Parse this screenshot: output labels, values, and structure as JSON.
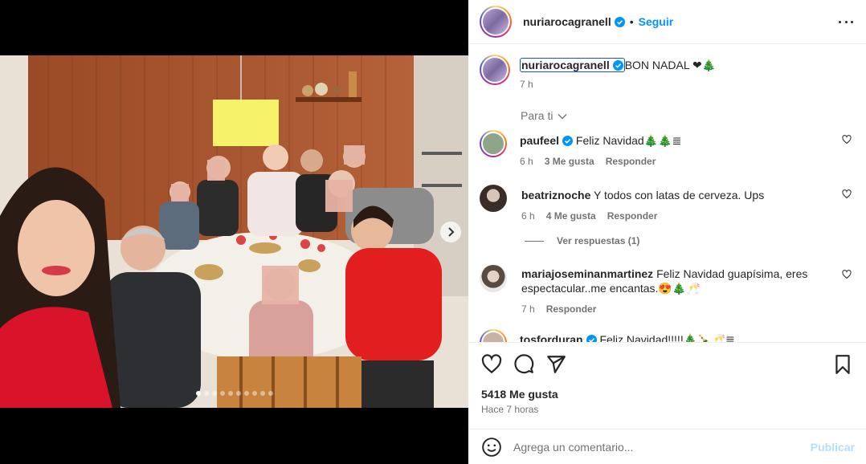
{
  "post": {
    "author": "nuriarocagranell",
    "follow_label": "Seguir",
    "separator": "•",
    "caption_text": "BON NADAL ❤🎄",
    "caption_time": "7 h",
    "filter_label": "Para ti",
    "likes": "5418 Me gusta",
    "posted_ago": "Hace 7 horas",
    "carousel": {
      "count": 10,
      "active_index": 0
    }
  },
  "comments": [
    {
      "user": "paufeel",
      "verified": true,
      "text": "Feliz Navidad🎄🎄≣",
      "time": "6 h",
      "likes": "3 Me gusta",
      "reply": "Responder"
    },
    {
      "user": "beatriznoche",
      "verified": false,
      "text": "Y todos con latas de cerveza. Ups",
      "time": "6 h",
      "likes": "4 Me gusta",
      "reply": "Responder",
      "view_replies": "Ver respuestas (1)"
    },
    {
      "user": "mariajoseminanmartinez",
      "verified": false,
      "text": "Feliz Navidad guapísima, eres espectacular..me encantas.😍🎄🥂",
      "time": "7 h",
      "reply": "Responder"
    },
    {
      "user": "tosforduran",
      "verified": true,
      "text": "Feliz Navidad!!!!!🎄🍾🥂≣"
    }
  ],
  "add_comment": {
    "placeholder": "Agrega un comentario...",
    "publish_label": "Publicar"
  },
  "icons": [
    "more-icon",
    "heart-icon",
    "comment-icon",
    "share-icon",
    "bookmark-icon",
    "emoji-icon",
    "verified-icon",
    "chevron-right-icon",
    "chevron-down-icon"
  ],
  "colors": {
    "link_blue": "#0095f6",
    "verified_blue": "#0095f6",
    "publish_disabled": "#b2dffc",
    "secondary_text": "#737373"
  }
}
